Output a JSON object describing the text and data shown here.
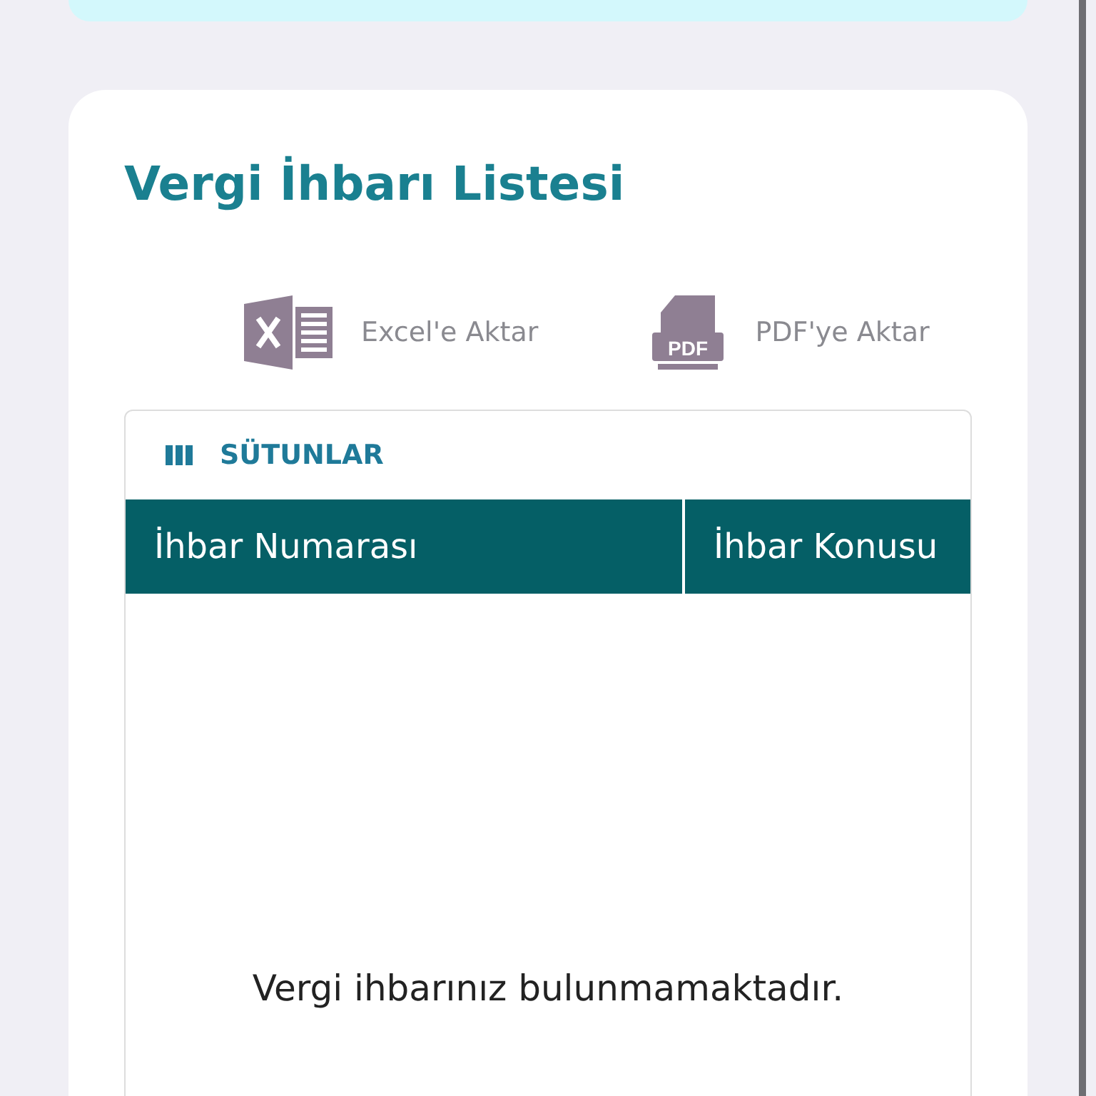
{
  "title": "Vergi İhbarı Listesi",
  "exports": [
    {
      "kind": "excel",
      "label": "Excel'e Aktar"
    },
    {
      "kind": "pdf",
      "label": "PDF'ye Aktar",
      "icon_text": "PDF"
    }
  ],
  "table": {
    "columns_button": "SÜTUNLAR",
    "columns": [
      "İhbar Numarası",
      "İhbar Konusu"
    ],
    "empty_message": "Vergi ihbarınız bulunmamaktadır."
  }
}
